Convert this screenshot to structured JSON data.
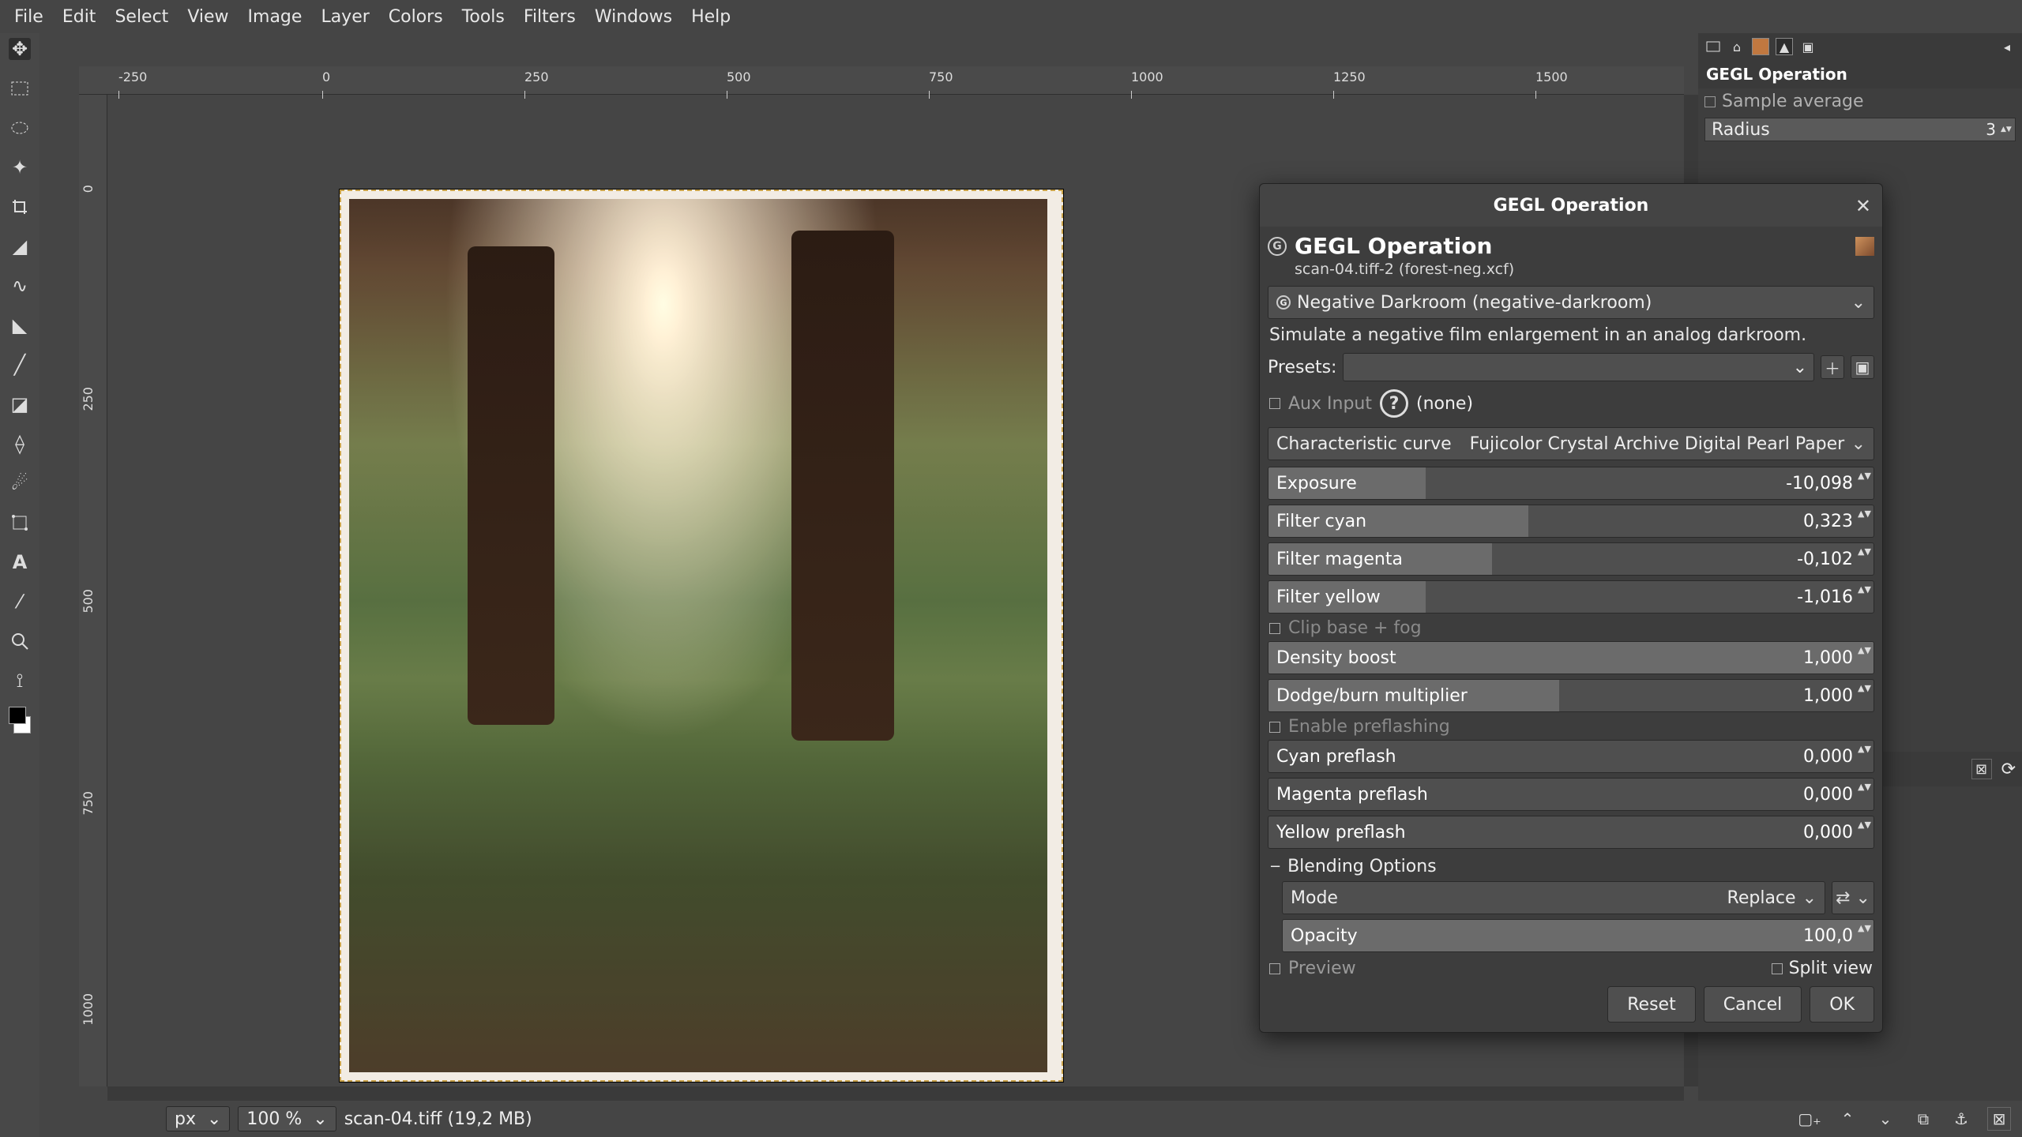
{
  "menubar": [
    "File",
    "Edit",
    "Select",
    "View",
    "Image",
    "Layer",
    "Colors",
    "Tools",
    "Filters",
    "Windows",
    "Help"
  ],
  "ruler_h": [
    "-250",
    "0",
    "250",
    "500",
    "750",
    "1000",
    "1250",
    "1500"
  ],
  "ruler_v": [
    "0",
    "250",
    "500",
    "750",
    "1000"
  ],
  "right_panel": {
    "title": "GEGL Operation",
    "row1_label": "Sample average",
    "radius_label": "Radius",
    "radius_value": "3"
  },
  "dialog": {
    "window_title": "GEGL Operation",
    "heading": "GEGL Operation",
    "subtitle": "scan-04.tiff-2 (forest-neg.xcf)",
    "op_select": "Negative Darkroom (negative-darkroom)",
    "description": "Simulate a negative film enlargement in an analog darkroom.",
    "presets_label": "Presets:",
    "aux_label": "Aux Input",
    "aux_value": "(none)",
    "curve_label": "Characteristic curve",
    "curve_value": "Fujicolor Crystal Archive Digital Pearl Paper",
    "sliders": [
      {
        "label": "Exposure",
        "value": "-10,098",
        "fill": 26
      },
      {
        "label": "Filter cyan",
        "value": "0,323",
        "fill": 43
      },
      {
        "label": "Filter magenta",
        "value": "-0,102",
        "fill": 37
      },
      {
        "label": "Filter yellow",
        "value": "-1,016",
        "fill": 26
      }
    ],
    "clip_label": "Clip base + fog",
    "sliders2": [
      {
        "label": "Density boost",
        "value": "1,000",
        "fill": 100
      },
      {
        "label": "Dodge/burn multiplier",
        "value": "1,000",
        "fill": 48
      }
    ],
    "preflash_label": "Enable preflashing",
    "sliders3": [
      {
        "label": "Cyan preflash",
        "value": "0,000",
        "fill": 0
      },
      {
        "label": "Magenta preflash",
        "value": "0,000",
        "fill": 0
      },
      {
        "label": "Yellow preflash",
        "value": "0,000",
        "fill": 0
      }
    ],
    "blend_label": "Blending Options",
    "mode_label": "Mode",
    "mode_value": "Replace",
    "opacity_label": "Opacity",
    "opacity_value": "100,0",
    "preview_label": "Preview",
    "split_label": "Split view",
    "buttons": {
      "reset": "Reset",
      "cancel": "Cancel",
      "ok": "OK"
    }
  },
  "status": {
    "unit": "px",
    "zoom": "100 %",
    "title": "scan-04.tiff (19,2 MB)"
  }
}
